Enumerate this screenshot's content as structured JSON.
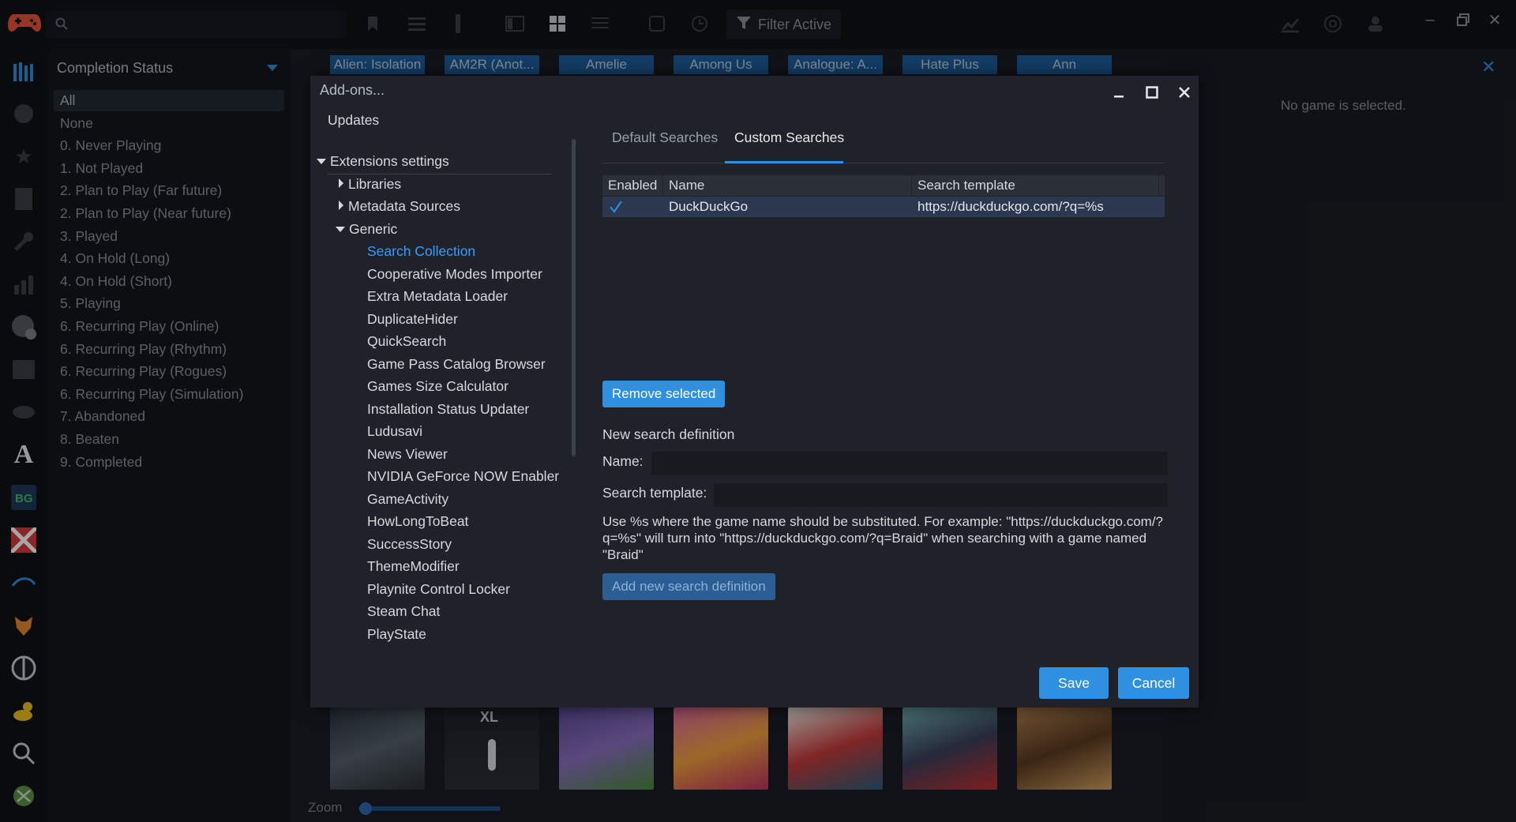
{
  "topbar": {
    "filter_active_label": "Filter Active",
    "icons": [
      "controller-logo-icon",
      "search-icon",
      "bookmark-icon",
      "list-icon",
      "column-icon",
      "sidebar-icon",
      "grid-icon",
      "list-view-icon",
      "dice-icon",
      "clock-icon",
      "filter-icon",
      "stats-icon",
      "globe-icon",
      "friends-icon"
    ]
  },
  "filter_panel": {
    "title": "Completion Status",
    "items": [
      {
        "label": "All",
        "selected": true
      },
      {
        "label": "None"
      },
      {
        "label": "0. Never Playing"
      },
      {
        "label": "1. Not Played"
      },
      {
        "label": "2. Plan to Play (Far future)"
      },
      {
        "label": "2. Plan to Play (Near future)"
      },
      {
        "label": "3. Played"
      },
      {
        "label": "4. On Hold (Long)"
      },
      {
        "label": "4. On Hold (Short)"
      },
      {
        "label": "5. Playing"
      },
      {
        "label": "6. Recurring Play (Online)"
      },
      {
        "label": "6. Recurring Play (Rhythm)"
      },
      {
        "label": "6. Recurring Play (Rogues)"
      },
      {
        "label": "6. Recurring Play (Simulation)"
      },
      {
        "label": "7. Abandoned"
      },
      {
        "label": "8. Beaten"
      },
      {
        "label": "9. Completed"
      }
    ]
  },
  "grid": {
    "game_tabs": [
      "Alien: Isolation",
      "AM2R (Anot...",
      "Amelie",
      "Among Us",
      "Analogue: A...",
      "Hate Plus",
      "Ann"
    ],
    "cover_overlay_text": "XL",
    "zoom_label": "Zoom",
    "zoom_level": 0.05
  },
  "details": {
    "empty_text": "No game is selected."
  },
  "dialog": {
    "title": "Add-ons...",
    "tree": {
      "updates": "Updates",
      "extensions_settings": "Extensions settings",
      "libraries": "Libraries",
      "metadata_sources": "Metadata Sources",
      "generic": "Generic",
      "generic_items": [
        "Search Collection",
        "Cooperative Modes Importer",
        "Extra Metadata Loader",
        "DuplicateHider",
        "QuickSearch",
        "Game Pass Catalog Browser",
        "Games Size Calculator",
        "Installation Status Updater",
        "Ludusavi",
        "News Viewer",
        "NVIDIA GeForce NOW Enabler",
        "GameActivity",
        "HowLongToBeat",
        "SuccessStory",
        "ThemeModifier",
        "Playnite Control Locker",
        "Steam Chat",
        "PlayState"
      ]
    },
    "tabs": {
      "default_searches": "Default Searches",
      "custom_searches": "Custom Searches"
    },
    "table": {
      "headers": [
        "Enabled",
        "Name",
        "Search template"
      ],
      "rows": [
        {
          "enabled": true,
          "name": "DuckDuckGo",
          "template": "https://duckduckgo.com/?q=%s"
        }
      ]
    },
    "remove_selected": "Remove selected",
    "new_definition_title": "New search definition",
    "name_label": "Name:",
    "name_value": "",
    "search_template_label": "Search template:",
    "search_template_value": "",
    "hint": "Use %s where the game name should be substituted. For example: \"https://duckduckgo.com/?q=%s\" will turn into \"https://duckduckgo.com/?q=Braid\" when searching with a game named \"Braid\"",
    "add_new": "Add new search definition",
    "save": "Save",
    "cancel": "Cancel"
  }
}
